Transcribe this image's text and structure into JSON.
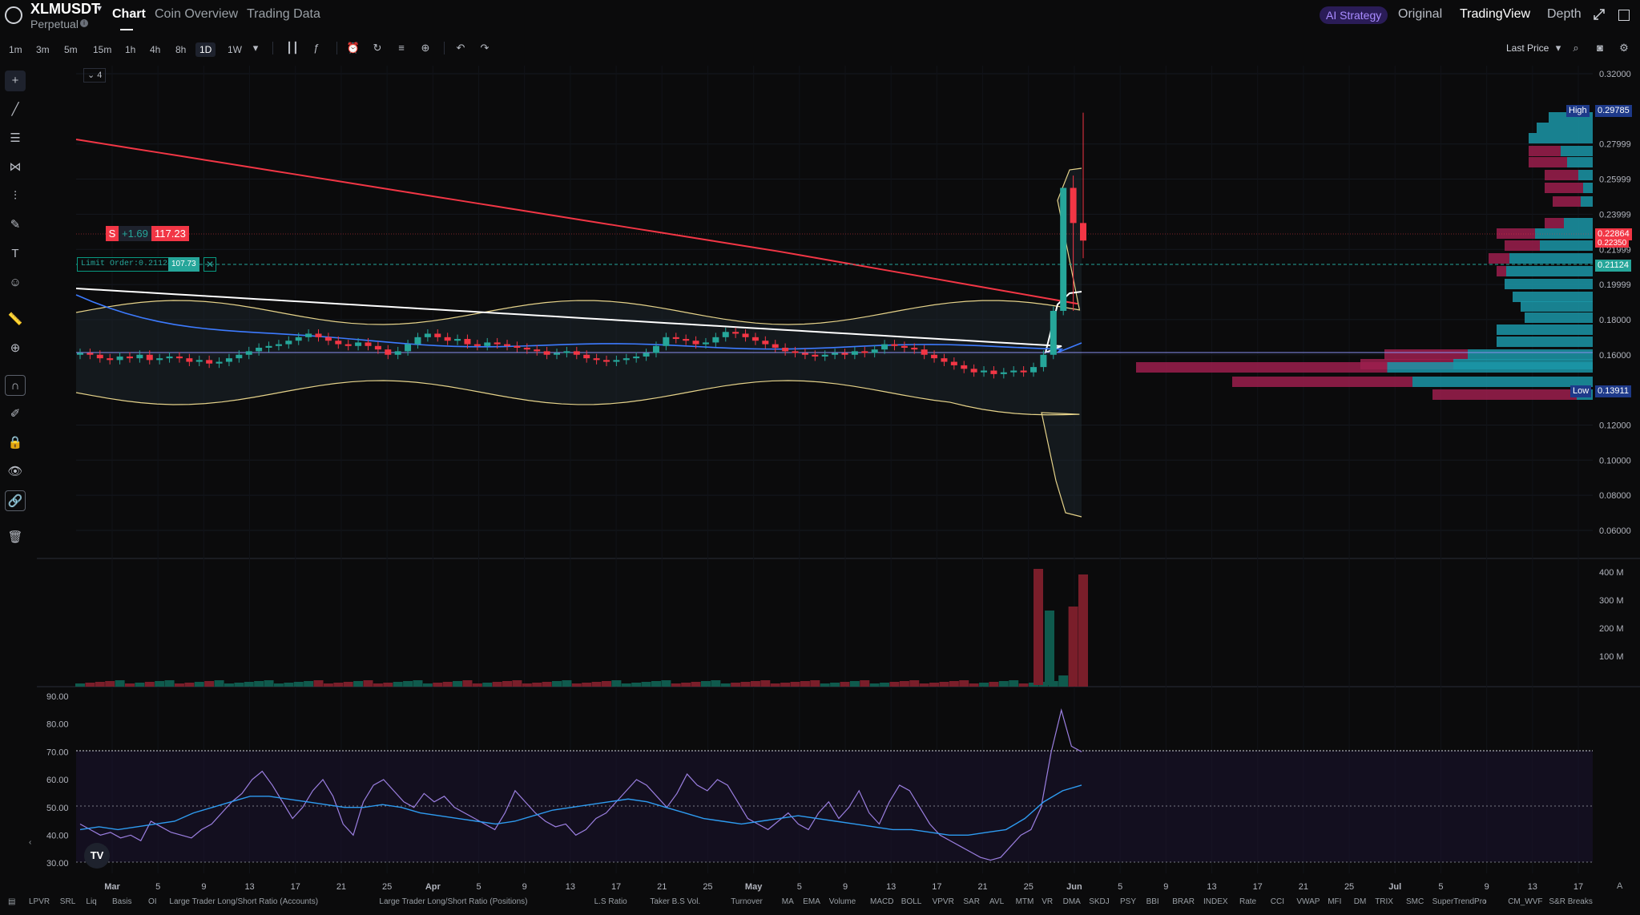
{
  "header": {
    "symbol": "XLMUSDT",
    "contract_type": "Perpetual",
    "tabs": [
      "Chart",
      "Coin Overview",
      "Trading Data"
    ],
    "active_tab": "Chart",
    "ai_strategy": "AI Strategy",
    "view_tabs": [
      "Original",
      "TradingView",
      "Depth"
    ],
    "active_view": "TradingView"
  },
  "toolbar": {
    "timeframes": [
      "1m",
      "3m",
      "5m",
      "15m",
      "1h",
      "4h",
      "8h",
      "1D",
      "1W"
    ],
    "selected_timeframe": "1D",
    "price_source": "Last Price"
  },
  "chart": {
    "collapse_count": "4",
    "position": {
      "side": "S",
      "pnl": "+1.69",
      "qty": "117.23"
    },
    "limit_order": {
      "label": "Limit Order:0.21124",
      "qty": "107.73",
      "close": "✕"
    },
    "price_axis": [
      "0.32000",
      "0.27999",
      "0.25999",
      "0.23999",
      "0.21999",
      "0.19999",
      "0.18000",
      "0.16000",
      "0.12000",
      "0.10000",
      "0.08000",
      "0.06000"
    ],
    "high_label": "High",
    "high_value": "0.29785",
    "low_label": "Low",
    "low_value": "0.13911",
    "last_price_tag": "0.22864",
    "last_price_tag2": "0.22350",
    "limit_price_tag": "0.21124",
    "volume_axis": [
      "400 M",
      "300 M",
      "200 M",
      "100 M"
    ],
    "rsi_axis": [
      "90.00",
      "80.00",
      "70.00",
      "60.00",
      "50.00",
      "40.00",
      "30.00"
    ],
    "time_axis": [
      "Mar",
      "5",
      "9",
      "13",
      "17",
      "21",
      "25",
      "Apr",
      "5",
      "9",
      "13",
      "17",
      "21",
      "25",
      "May",
      "5",
      "9",
      "13",
      "17",
      "21",
      "25",
      "Jun",
      "5",
      "9",
      "13",
      "17",
      "21",
      "25",
      "Jul",
      "5",
      "9",
      "13",
      "17"
    ],
    "time_axis_corner": "A",
    "tv_badge": "TV"
  },
  "indicators": [
    "LPVR",
    "SRL",
    "Liq",
    "Basis",
    "OI",
    "Large Trader Long/Short Ratio (Accounts)",
    "Large Trader Long/Short Ratio (Positions)",
    "L.S Ratio",
    "Taker B.S Vol.",
    "Turnover",
    "MA",
    "EMA",
    "Volume",
    "MACD",
    "BOLL",
    "VPVR",
    "SAR",
    "AVL",
    "MTM",
    "VR",
    "DMA",
    "SKDJ",
    "PSY",
    "BBI",
    "BRAR",
    "INDEX",
    "Rate",
    "CCI",
    "VWAP",
    "MFI",
    "DM",
    "TRIX",
    "SMC",
    "SuperTrendPro",
    "CM_WVF",
    "S&R Breaks"
  ],
  "colors": {
    "up": "#26a69a",
    "down": "#f23645",
    "accent": "#a98bff",
    "bg": "#0b0b0c"
  }
}
